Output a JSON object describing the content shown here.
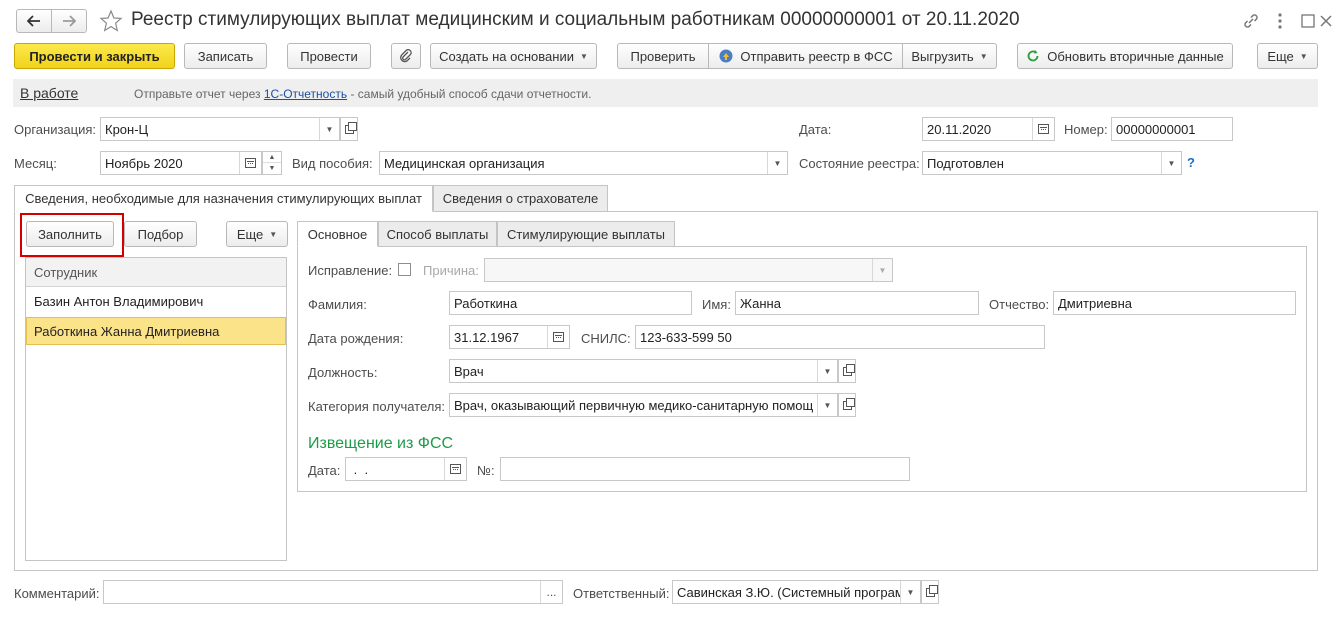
{
  "window": {
    "title": "Реестр стимулирующих выплат медицинским и социальным работникам 00000000001 от 20.11.2020",
    "back_icon": "arrow-left-icon",
    "forward_icon": "arrow-right-icon",
    "star_icon": "star-icon",
    "link_icon": "link-icon",
    "menu_icon": "more-vertical-icon",
    "maximize_icon": "maximize-icon",
    "close_icon": "close-icon"
  },
  "toolbar": {
    "post_close": "Провести и закрыть",
    "save": "Записать",
    "post": "Провести",
    "create_based_on": "Создать на основании",
    "check": "Проверить",
    "send_fss": "Отправить реестр в ФСС",
    "export": "Выгрузить",
    "refresh_secondary": "Обновить вторичные данные",
    "more": "Еще"
  },
  "info_bar": {
    "status_link": "В работе",
    "text_before": "Отправьте отчет через",
    "link": "1С-Отчетность",
    "text_after": " - самый удобный способ сдачи отчетности."
  },
  "header_fields": {
    "org_label": "Организация:",
    "org_value": "Крон-Ц",
    "date_label": "Дата:",
    "date_value": "20.11.2020",
    "number_label": "Номер:",
    "number_value": "00000000001",
    "month_label": "Месяц:",
    "month_value": "Ноябрь 2020",
    "benefit_label": "Вид пособия:",
    "benefit_value": "Медицинская организация",
    "state_label": "Состояние реестра:",
    "state_value": "Подготовлен",
    "help": "?"
  },
  "outer_tabs": [
    {
      "label": "Сведения, необходимые для назначения стимулирующих выплат"
    },
    {
      "label": "Сведения о страхователе"
    }
  ],
  "left_panel": {
    "fill": "Заполнить",
    "select": "Подбор",
    "more": "Еще",
    "column_header": "Сотрудник",
    "rows": [
      {
        "name": "Базин Антон Владимирович"
      },
      {
        "name": "Работкина Жанна Дмитриевна"
      }
    ]
  },
  "inner_tabs": [
    {
      "label": "Основное"
    },
    {
      "label": "Способ выплаты"
    },
    {
      "label": "Стимулирующие выплаты"
    }
  ],
  "details": {
    "correction_label": "Исправление:",
    "reason_label": "Причина:",
    "reason_value": "",
    "surname_label": "Фамилия:",
    "surname_value": "Работкина",
    "name_label": "Имя:",
    "name_value": "Жанна",
    "patronymic_label": "Отчество:",
    "patronymic_value": "Дмитриевна",
    "birth_label": "Дата рождения:",
    "birth_value": "31.12.1967",
    "snils_label": "СНИЛС:",
    "snils_value": "123-633-599 50",
    "position_label": "Должность:",
    "position_value": "Врач",
    "category_label": "Категория получателя:",
    "category_value": "Врач, оказывающий первичную медико-санитарную помощ",
    "notice_title": "Извещение из ФСС",
    "notice_date_label": "Дата:",
    "notice_date_value": " .  .",
    "notice_no_label": "№:",
    "notice_no_value": ""
  },
  "footer": {
    "comment_label": "Комментарий:",
    "comment_value": "",
    "comment_btn": "...",
    "responsible_label": "Ответственный:",
    "responsible_value": "Савинская З.Ю. (Системный програм"
  },
  "colors": {
    "primary_button": "#f2d21d",
    "highlight_frame": "#d40000",
    "selected_row": "#fbe38a",
    "notice_title": "#1b9c47",
    "link": "#1a4fa3",
    "info_bar": "#efefef"
  }
}
